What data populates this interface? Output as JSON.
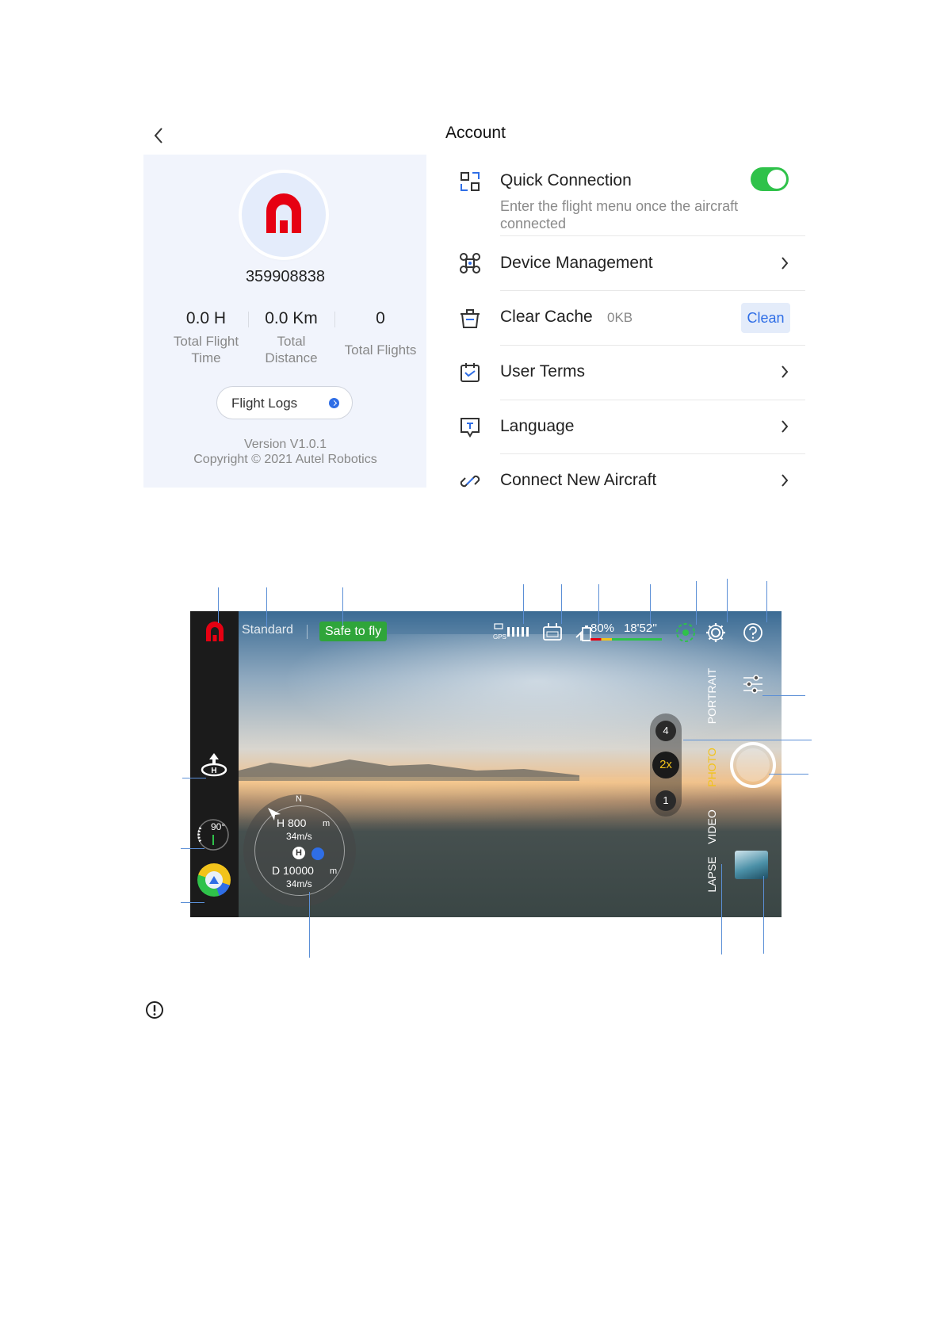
{
  "account": {
    "title": "Account",
    "user_id": "359908838",
    "stats": [
      {
        "value": "0.0 H",
        "label_line1": "Total Flight",
        "label_line2": "Time"
      },
      {
        "value": "0.0 Km",
        "label_line1": "Total",
        "label_line2": "Distance"
      },
      {
        "value": "0",
        "label_line1": "Total Flights",
        "label_line2": ""
      }
    ],
    "flight_logs_label": "Flight Logs",
    "version": "Version V1.0.1",
    "copyright": "Copyright © 2021 Autel Robotics",
    "quick_connection": {
      "title": "Quick Connection",
      "desc_line1": "Enter the flight menu once the aircraft",
      "desc_line2": "connected",
      "enabled": true
    },
    "menu": [
      {
        "label": "Device Management",
        "icon": "drone-icon"
      },
      {
        "label": "Clear Cache",
        "icon": "trash-icon",
        "size": "0KB",
        "action": "Clean"
      },
      {
        "label": "User Terms",
        "icon": "calendar-icon"
      },
      {
        "label": "Language",
        "icon": "translate-icon"
      },
      {
        "label": "Connect New Aircraft",
        "icon": "link-icon"
      }
    ],
    "accent_color": "#2f6ee6",
    "toggle_color": "#2fc24a",
    "brand_color": "#e60012"
  },
  "camera": {
    "flight_mode": "Standard",
    "status": "Safe to fly",
    "battery": "80%",
    "flight_time": "18'52''",
    "gps_label": "GPS",
    "gimbal_angle": "90°",
    "modes": [
      "PORTRAIT",
      "PHOTO",
      "VIDEO",
      "LAPSE"
    ],
    "active_mode": "PHOTO",
    "zoom_levels": [
      "4",
      "2x",
      "1"
    ],
    "radar": {
      "north": "N",
      "height": "H 800",
      "height_unit": "m",
      "vspeed": "34m/s",
      "home": "H",
      "distance": "D 10000",
      "distance_unit": "m",
      "hspeed": "34m/s"
    },
    "status_color": "#2fa53a",
    "active_mode_color": "#f2c31b"
  }
}
